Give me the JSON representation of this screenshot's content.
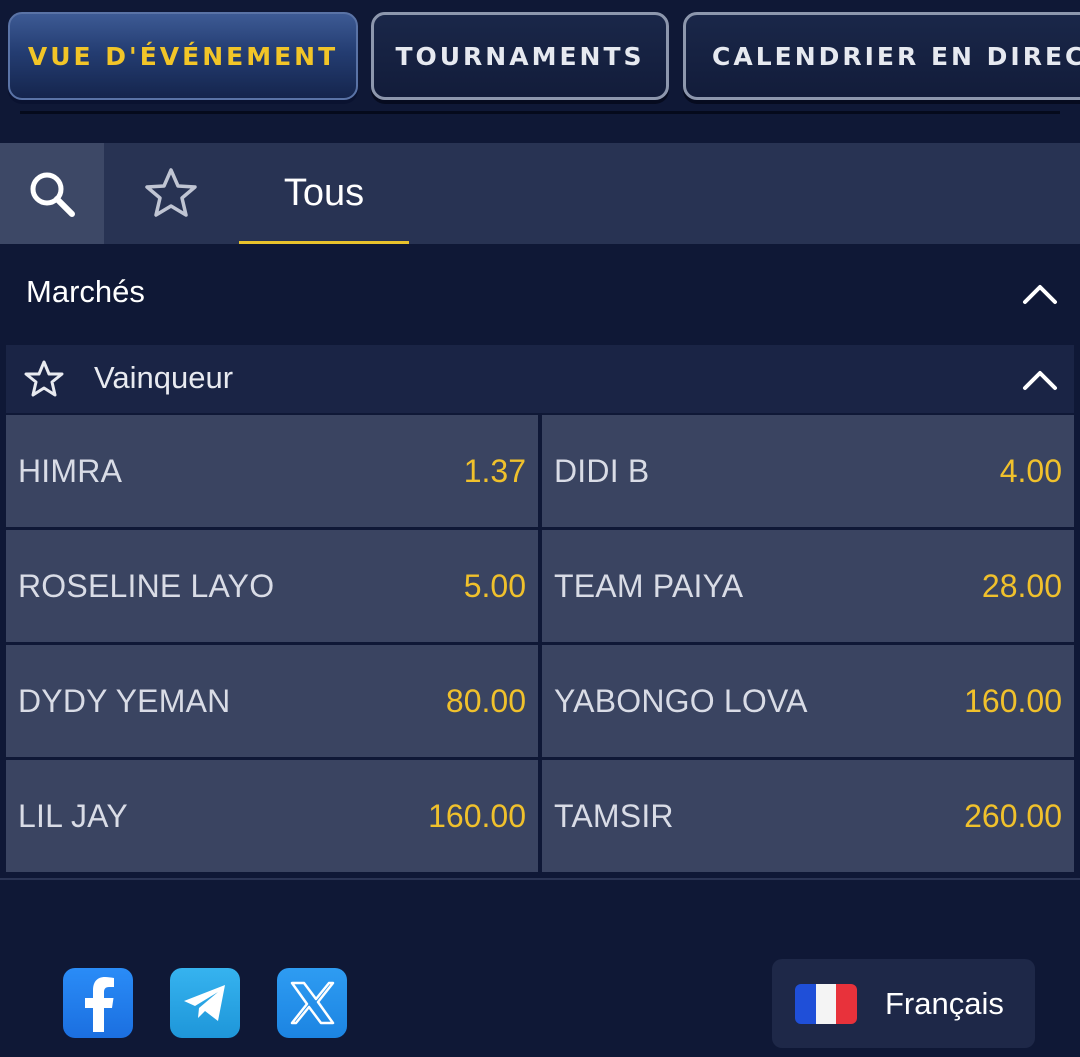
{
  "nav": {
    "tabs": [
      {
        "label": "VUE D'ÉVÉNEMENT",
        "active": true
      },
      {
        "label": "TOURNAMENTS",
        "active": false
      },
      {
        "label": "CALENDRIER EN DIRECT",
        "active": false
      }
    ]
  },
  "filter": {
    "search_icon": "search-icon",
    "favorites_icon": "star-outline-icon",
    "tab_all": "Tous"
  },
  "markets": {
    "title": "Marchés",
    "icon": "chevron-up-icon"
  },
  "market": {
    "name": "Vainqueur",
    "outcomes": [
      {
        "name": "HIMRA",
        "odds": "1.37"
      },
      {
        "name": "DIDI B",
        "odds": "4.00"
      },
      {
        "name": "ROSELINE LAYO",
        "odds": "5.00"
      },
      {
        "name": "TEAM PAIYA",
        "odds": "28.00"
      },
      {
        "name": "DYDY YEMAN",
        "odds": "80.00"
      },
      {
        "name": "YABONGO LOVA",
        "odds": "160.00"
      },
      {
        "name": "LIL JAY",
        "odds": "160.00"
      },
      {
        "name": "TAMSIR",
        "odds": "260.00"
      }
    ]
  },
  "footer": {
    "social": [
      "facebook-icon",
      "telegram-icon",
      "x-icon"
    ],
    "language": "Français"
  },
  "colors": {
    "accent_yellow": "#f0c12c",
    "background": "#0f1836",
    "cell": "#3a4461"
  }
}
